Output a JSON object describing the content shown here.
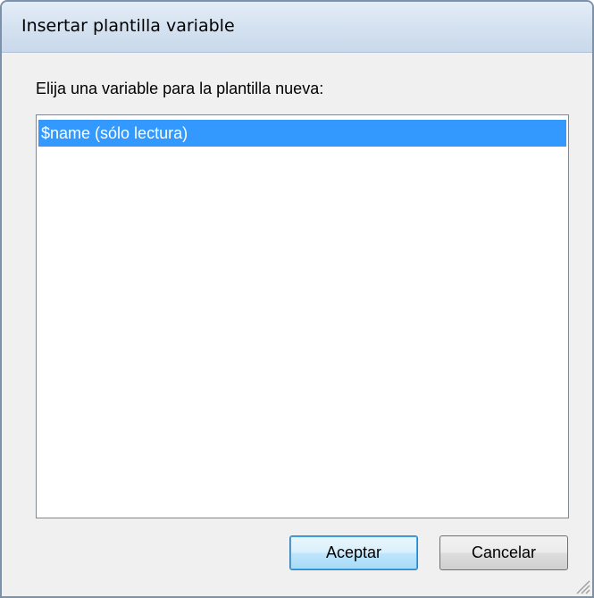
{
  "window": {
    "title": "Insertar plantilla variable"
  },
  "dialog": {
    "prompt": "Elija una variable para la plantilla nueva:",
    "variables": [
      {
        "label": "$name (sólo lectura)",
        "selected": true
      }
    ],
    "accept_label": "Aceptar",
    "cancel_label": "Cancelar"
  },
  "colors": {
    "selection": "#3399ff",
    "titlebar": "#d6e3f1",
    "dialog_bg": "#f0f0f0"
  },
  "icons": {
    "resize": "resize-grip-icon"
  }
}
